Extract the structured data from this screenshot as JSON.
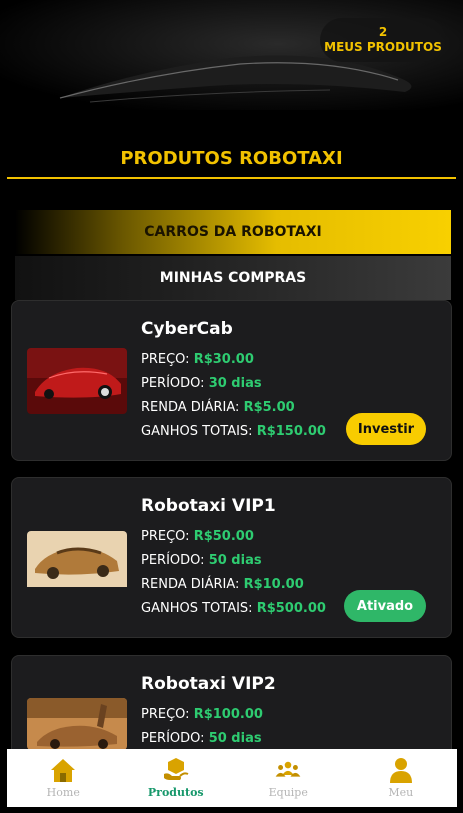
{
  "header": {
    "my_products_count": "2",
    "my_products_label": "MEUS PRODUTOS"
  },
  "page_title": "PRODUTOS ROBOTAXI",
  "tabs": [
    {
      "label": "CARROS DA ROBOTAXI",
      "active": true
    },
    {
      "label": "MINHAS COMPRAS",
      "active": false
    }
  ],
  "products": [
    {
      "name": "CyberCab",
      "price_label": "PREÇO:",
      "price": "R$30.00",
      "period_label": "PERÍODO:",
      "period": "30 dias",
      "daily_label": "RENDA DIÁRIA:",
      "daily": "R$5.00",
      "total_label": "GANHOS TOTAIS:",
      "total": "R$150.00",
      "button": "Investir",
      "image": "red-cybercab"
    },
    {
      "name": "Robotaxi VIP1",
      "price_label": "PREÇO:",
      "price": "R$50.00",
      "period_label": "PERÍODO:",
      "period": "50 dias",
      "daily_label": "RENDA DIÁRIA:",
      "daily": "R$10.00",
      "total_label": "GANHOS TOTAIS:",
      "total": "R$500.00",
      "button": "Ativado",
      "image": "gold-sedan"
    },
    {
      "name": "Robotaxi VIP2",
      "price_label": "PREÇO:",
      "price": "R$100.00",
      "period_label": "PERÍODO:",
      "period": "50 dias",
      "image": "gold-gullwing"
    }
  ],
  "nav": [
    {
      "label": "Home",
      "icon": "home-icon",
      "active": false
    },
    {
      "label": "Produtos",
      "icon": "box-icon",
      "active": true
    },
    {
      "label": "Equipe",
      "icon": "team-icon",
      "active": false
    },
    {
      "label": "Meu",
      "icon": "user-icon",
      "active": false
    }
  ],
  "colors": {
    "accent": "#f2c200",
    "value_green": "#2ecc71",
    "active_button": "#2fb768",
    "card_bg": "#1c1c1e",
    "nav_active": "#17986b"
  }
}
